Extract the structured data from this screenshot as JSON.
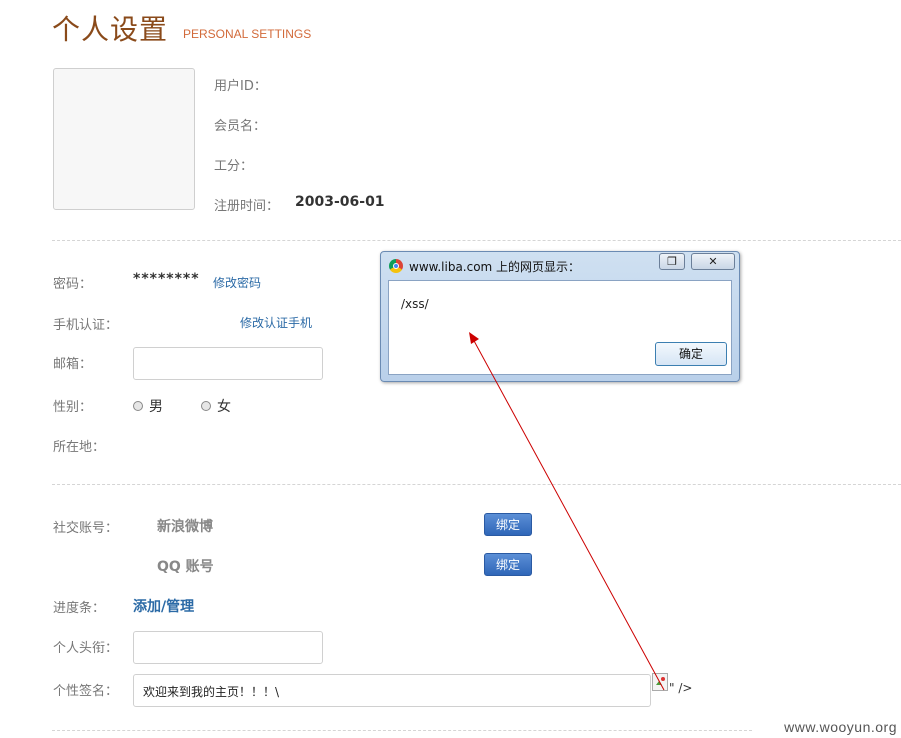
{
  "header": {
    "title_cn": "个人设置",
    "title_en": "PERSONAL SETTINGS"
  },
  "profile": {
    "user_id_label": "用户ID：",
    "member_name_label": "会员名：",
    "points_label": "工分：",
    "register_label": "注册时间：",
    "register_value": "2003-06-01"
  },
  "account": {
    "password_label": "密码：",
    "password_value": "********",
    "change_password": "修改密码",
    "phone_label": "手机认证：",
    "phone_value": "- - - -",
    "change_phone": "修改认证手机",
    "email_label": "邮箱：",
    "gender_label": "性别：",
    "gender_male": "男",
    "gender_female": "女",
    "location_label": "所在地："
  },
  "social": {
    "section_label": "社交账号：",
    "weibo_label": "新浪微博",
    "qq_label": "QQ 账号",
    "bind_label": "绑定"
  },
  "extra": {
    "progress_label": "进度条：",
    "progress_link": "添加/管理",
    "title_label": "个人头衔：",
    "signature_label": "个性签名：",
    "signature_value": "欢迎来到我的主页！！！\\",
    "injected_tail": "\" />"
  },
  "dialog": {
    "title": "www.liba.com 上的网页显示：",
    "message": "/xss/",
    "ok_label": "确定",
    "restore_symbol": "❐",
    "close_symbol": "✕"
  },
  "watermark": "www.wooyun.org",
  "colors": {
    "accent_title": "#8a4a1a",
    "link": "#2b6aa6",
    "bind_button": "#3a72c4",
    "annotation_arrow": "#cc0000"
  }
}
